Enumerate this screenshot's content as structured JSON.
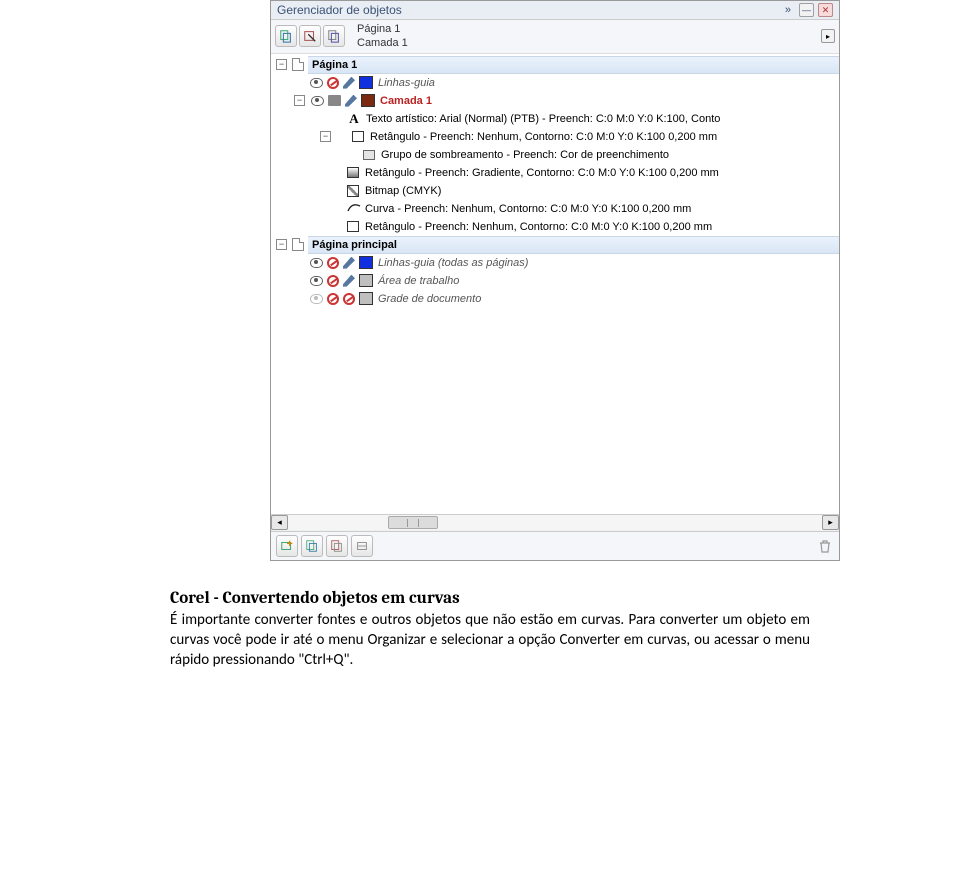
{
  "panel": {
    "title": "Gerenciador de objetos",
    "context_line1": "Página 1",
    "context_line2": "Camada 1",
    "arrow_more": "▸"
  },
  "tree": {
    "page1": {
      "label": "Página 1",
      "guideLayer": "Linhas-guia",
      "layer1": {
        "label": "Camada 1",
        "items": [
          "Texto artístico: Arial (Normal) (PTB) - Preench: C:0 M:0 Y:0 K:100, Conto",
          "Retângulo - Preench: Nenhum, Contorno: C:0 M:0 Y:0 K:100  0,200 mm",
          "Grupo de sombreamento - Preench: Cor de preenchimento",
          "Retângulo - Preench: Gradiente, Contorno: C:0 M:0 Y:0 K:100  0,200 mm",
          "Bitmap (CMYK)",
          "Curva - Preench: Nenhum, Contorno: C:0 M:0 Y:0 K:100  0,200 mm",
          "Retângulo - Preench: Nenhum, Contorno: C:0 M:0 Y:0 K:100  0,200 mm"
        ]
      }
    },
    "master": {
      "label": "Página principal",
      "items": [
        "Linhas-guia (todas as páginas)",
        "Área de trabalho",
        "Grade de documento"
      ]
    }
  },
  "article": {
    "heading": "Corel - Convertendo objetos em curvas",
    "body": "É importante converter fontes e outros objetos que não estão em curvas. Para converter um objeto em curvas você pode ir até o menu Organizar e selecionar a opção Converter em curvas, ou acessar o menu rápido pressionando \"Ctrl+Q\"."
  }
}
